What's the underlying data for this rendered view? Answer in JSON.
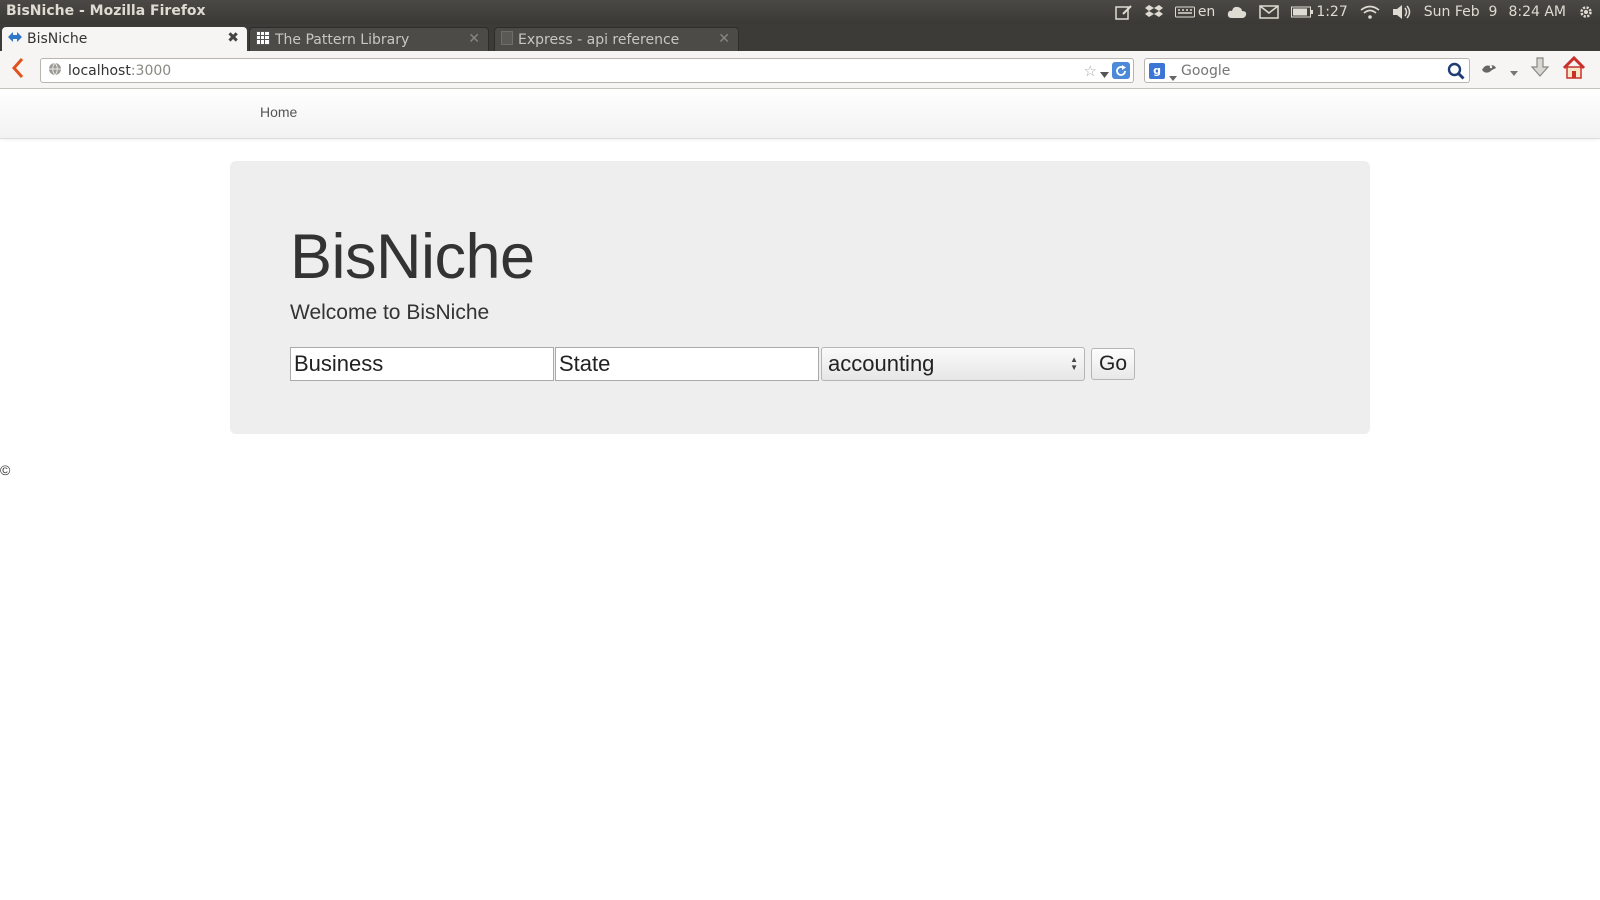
{
  "window": {
    "title": "BisNiche - Mozilla Firefox",
    "tray": {
      "keyboard_layout": "en",
      "battery_time": "1:27",
      "date": "Sun Feb  9",
      "time": "8:24 AM"
    }
  },
  "tabs": [
    {
      "label": "BisNiche",
      "active": true,
      "icon": "bisniche-favicon"
    },
    {
      "label": "The Pattern Library",
      "active": false,
      "icon": "pattern-library-favicon"
    },
    {
      "label": "Express - api reference",
      "active": false,
      "icon": "blank-page-icon"
    }
  ],
  "navbar": {
    "url_host": "localhost",
    "url_port": ":3000",
    "search_placeholder": "Google"
  },
  "site": {
    "nav_home": "Home",
    "heading": "BisNiche",
    "lead": "Welcome to BisNiche",
    "business_value": "Business",
    "state_value": "State",
    "category_selected": "accounting",
    "go_label": "Go",
    "footer": "©"
  },
  "colors": {
    "jumbotron_bg": "#eeeeee",
    "os_bar_bg": "#3c3b37",
    "link_blue": "#3b76d6"
  }
}
